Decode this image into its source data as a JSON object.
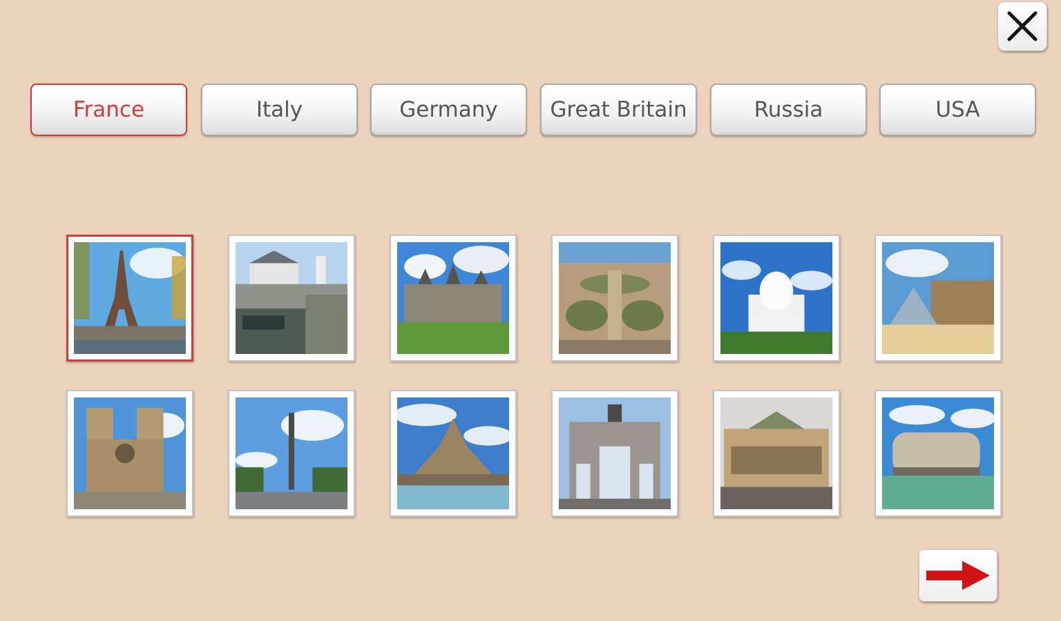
{
  "colors": {
    "background": "#ecd3bd",
    "accent": "#d33a3a",
    "tab_text": "#565656"
  },
  "close_icon": "close-icon",
  "next_icon": "right-arrow-icon",
  "tabs": [
    {
      "label": "France",
      "active": true
    },
    {
      "label": "Italy",
      "active": false
    },
    {
      "label": "Germany",
      "active": false
    },
    {
      "label": "Great Britain",
      "active": false
    },
    {
      "label": "Russia",
      "active": false
    },
    {
      "label": "USA",
      "active": false
    }
  ],
  "thumbnails": [
    {
      "subject": "eiffel-tower",
      "selected": true
    },
    {
      "subject": "chateau-de-chenonceau",
      "selected": false
    },
    {
      "subject": "chateau-de-chambord",
      "selected": false
    },
    {
      "subject": "versailles-gardens",
      "selected": false
    },
    {
      "subject": "sacre-coeur",
      "selected": false
    },
    {
      "subject": "louvre-pyramid",
      "selected": false
    },
    {
      "subject": "notre-dame",
      "selected": false
    },
    {
      "subject": "place-de-la-bastille",
      "selected": false
    },
    {
      "subject": "mont-saint-michel",
      "selected": false
    },
    {
      "subject": "arc-du-carrousel",
      "selected": false
    },
    {
      "subject": "palais-garnier",
      "selected": false
    },
    {
      "subject": "fort-boyard",
      "selected": false
    }
  ]
}
